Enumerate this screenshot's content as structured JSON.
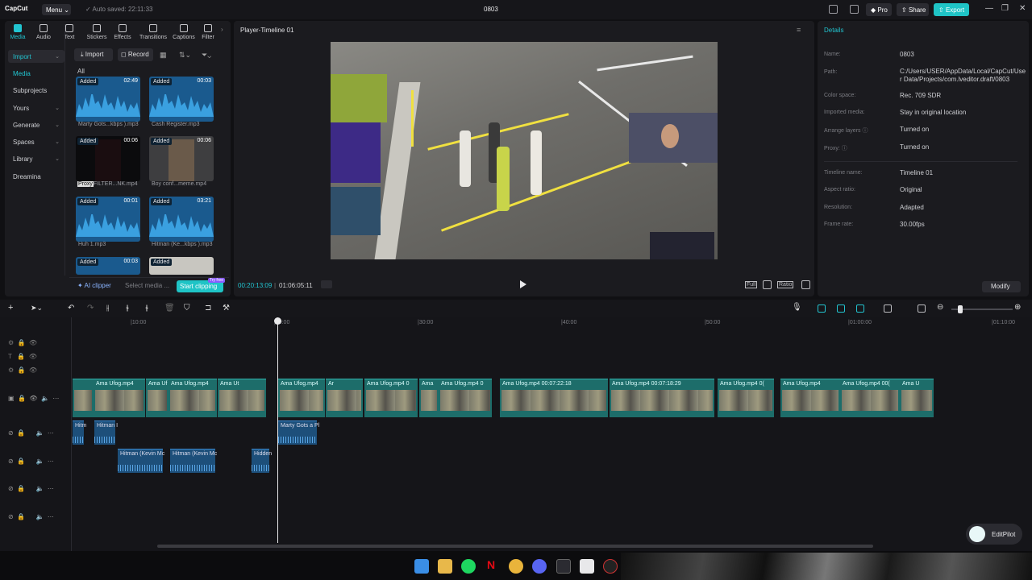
{
  "titlebar": {
    "app_name": "CapCut",
    "menu_label": "Menu",
    "autosave": "Auto saved: 22:11:33",
    "project_title": "0803",
    "pro_label": "Pro",
    "share_label": "Share",
    "export_label": "Export"
  },
  "media_tabs": [
    {
      "label": "Media"
    },
    {
      "label": "Audio"
    },
    {
      "label": "Text"
    },
    {
      "label": "Stickers"
    },
    {
      "label": "Effects"
    },
    {
      "label": "Transitions"
    },
    {
      "label": "Captions"
    },
    {
      "label": "Filter"
    }
  ],
  "sidebar": {
    "items": [
      {
        "label": "Import"
      },
      {
        "label": "Media"
      },
      {
        "label": "Subprojects"
      },
      {
        "label": "Yours"
      },
      {
        "label": "Generate"
      },
      {
        "label": "Spaces"
      },
      {
        "label": "Library"
      },
      {
        "label": "Dreamina"
      }
    ]
  },
  "media": {
    "import_button": "Import",
    "record_button": "Record",
    "all_label": "All",
    "items": [
      {
        "status": "Added",
        "duration": "02:49",
        "name": "Marty Gots...kbps ).mp3"
      },
      {
        "status": "Added",
        "duration": "00:03",
        "name": "Cash Register.mp3"
      },
      {
        "status": "Added",
        "duration": "00:06",
        "name": "FILTER...NK.mp4",
        "badge": "Proxy"
      },
      {
        "status": "Added",
        "duration": "00:06",
        "name": "Boy conf...meme.mp4"
      },
      {
        "status": "Added",
        "duration": "00:01",
        "name": "Huh 1.mp3"
      },
      {
        "status": "Added",
        "duration": "03:21",
        "name": "Hitman (Ke...kbps ).mp3"
      },
      {
        "status": "Added",
        "duration": "00:03",
        "name": ""
      },
      {
        "status": "Added",
        "duration": "",
        "name": ""
      }
    ],
    "ai_clipper": "AI clipper",
    "select_media": "Select media ...",
    "start_clipping": "Start clipping",
    "try_free": "Try free"
  },
  "player": {
    "title": "Player-Timeline 01",
    "current_time": "00:20:13:09",
    "total_time": "01:06:05:11",
    "full_label": "Full",
    "ratio_label": "Ratio"
  },
  "details": {
    "title": "Details",
    "fields": [
      {
        "key": "Name:",
        "value": "0803"
      },
      {
        "key": "Path:",
        "value": "C:/Users/USER/AppData/Local/CapCut/User Data/Projects/com.lveditor.draft/0803"
      },
      {
        "key": "Color space:",
        "value": "Rec. 709 SDR"
      },
      {
        "key": "Imported media:",
        "value": "Stay in original location"
      },
      {
        "key": "Arrange layers",
        "value": "Turned on"
      },
      {
        "key": "Proxy:",
        "value": "Turned on"
      },
      {
        "key": "Timeline name:",
        "value": "Timeline 01"
      },
      {
        "key": "Aspect ratio:",
        "value": "Original"
      },
      {
        "key": "Resolution:",
        "value": "Adapted"
      },
      {
        "key": "Frame rate:",
        "value": "30.00fps"
      }
    ],
    "modify_button": "Modify"
  },
  "timeline": {
    "ruler": [
      "|10:00",
      "|00:00",
      "|30:00",
      "|40:00",
      "|50:00",
      "|01:00:00",
      "|01:10:00"
    ],
    "video_clips": [
      {
        "label": "Ama Ufog.mp4"
      },
      {
        "label": "Ama Uf"
      },
      {
        "label": "Ama Ufog.mp4"
      },
      {
        "label": "Ama Ut"
      },
      {
        "label": "Ama Ufog.mp4"
      },
      {
        "label": "Ar"
      },
      {
        "label": "Ama Ufog.mp4  0"
      },
      {
        "label": "Ama"
      },
      {
        "label": "Ama Ufog.mp4  0"
      },
      {
        "label": "Ama Ufog.mp4  00:07:22:18"
      },
      {
        "label": "Ama Ufog.mp4  00:07:18:29"
      },
      {
        "label": "Ama Ufog.mp4  0("
      },
      {
        "label": "Ama Ufog.mp4"
      },
      {
        "label": "Ama Ufog.mp4  00("
      },
      {
        "label": "Ama U"
      }
    ],
    "audio_clips_1": [
      {
        "label": "Hitm"
      },
      {
        "label": "Hitman I"
      },
      {
        "label": "Marty Gots a Pl"
      }
    ],
    "audio_clips_2": [
      {
        "label": "Hitman (Kevin Mc"
      },
      {
        "label": "Hitman (Kevin Mc"
      },
      {
        "label": "Hidden"
      }
    ]
  },
  "editpilot": {
    "label": "EditPilot"
  },
  "colors": {
    "accent": "#1fc4c6",
    "video_clip": "#1d6d6a",
    "audio_clip": "#1d4f7a"
  }
}
